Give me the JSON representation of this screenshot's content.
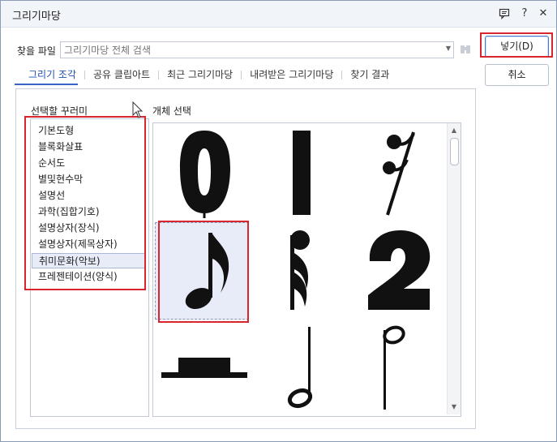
{
  "window": {
    "title": "그리기마당"
  },
  "titlebar": {
    "help": "?",
    "close": "✕"
  },
  "search": {
    "label": "찾을 파일",
    "placeholder": "그리기마당 전체 검색",
    "value": ""
  },
  "buttons": {
    "insert": "넣기(D)",
    "cancel": "취소"
  },
  "tabs": [
    {
      "label": "그리기 조각",
      "active": true
    },
    {
      "label": "공유 클립아트"
    },
    {
      "label": "최근 그리기마당"
    },
    {
      "label": "내려받은 그리기마당"
    },
    {
      "label": "찾기 결과"
    }
  ],
  "categories": {
    "heading": "선택할 꾸러미",
    "items": [
      "기본도형",
      "블록화살표",
      "순서도",
      "별및현수막",
      "설명선",
      "과학(집합기호)",
      "설명상자(장식)",
      "설명상자(제목상자)",
      "취미문화(악보)",
      "프레젠테이션(양식)"
    ],
    "selected_index": 8
  },
  "objects": {
    "heading": "개체 선택",
    "items": [
      "zero-symbol",
      "bar-line",
      "sixteenth-rest",
      "eighth-note",
      "double-flag-note",
      "numeral-two",
      "whole-rest",
      "half-note-down",
      "half-note-up"
    ],
    "selected_index": 3
  },
  "colors": {
    "accent": "#3a63c8",
    "highlight": "#d9262e",
    "selection": "#e8ecf8"
  }
}
